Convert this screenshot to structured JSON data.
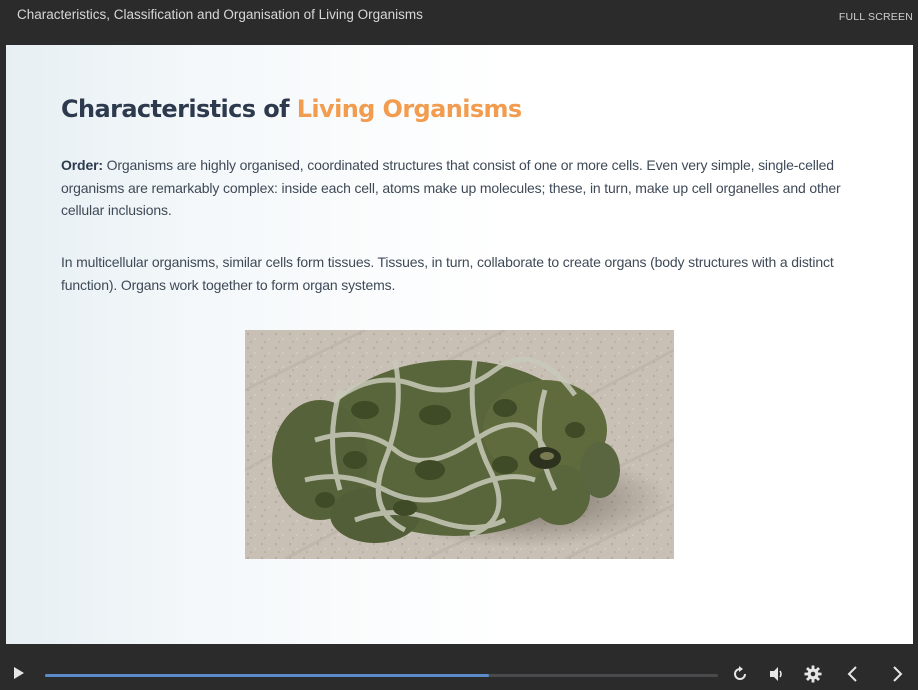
{
  "window": {
    "course_title": "Characteristics, Classification and Organisation of Living Organisms",
    "fullscreen_label": "FULL SCREEN"
  },
  "slide": {
    "heading_main": "Characteristics of ",
    "heading_accent": "Living Organisms",
    "p1_label": "Order:",
    "p1_text": " Organisms are highly organised, coordinated structures that consist of one or more cells. Even very simple, single-celled organisms are remarkably complex: inside each cell, atoms make up molecules; these, in turn, make up cell organelles and other cellular inclusions.",
    "p2_text": "In multicellular organisms, similar cells form tissues. Tissues, in turn, collaborate to create organs (body structures with a distinct function). Organs work together to form organ systems.",
    "image_icon": "toad-photo"
  },
  "player": {
    "progress": 0.66,
    "icons": [
      "play-icon",
      "replay-icon",
      "volume-icon",
      "settings-icon",
      "prev-icon",
      "next-icon"
    ]
  },
  "colors": {
    "accent": "#f29c4f",
    "heading": "#2d3a4d",
    "seek_fill": "#5b8bc8",
    "bar_bg": "#2b2b2c"
  }
}
